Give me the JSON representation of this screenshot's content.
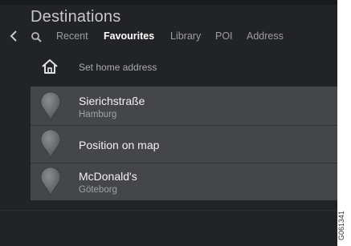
{
  "header": {
    "title": "Destinations"
  },
  "tabs": [
    {
      "label": "Recent",
      "active": false
    },
    {
      "label": "Favourites",
      "active": true
    },
    {
      "label": "Library",
      "active": false
    },
    {
      "label": "POI",
      "active": false
    },
    {
      "label": "Address",
      "active": false
    }
  ],
  "home": {
    "label": "Set home address",
    "icon": "home-icon"
  },
  "favourites": [
    {
      "name": "Sierichstraße",
      "city": "Hamburg",
      "icon": "location-pin-icon"
    },
    {
      "name": "Position on map",
      "city": "",
      "icon": "location-pin-icon"
    },
    {
      "name": "McDonald's",
      "city": "Göteborg",
      "icon": "location-pin-icon"
    }
  ],
  "figure_code": "G061341",
  "colors": {
    "background": "#222326",
    "list_background": "#444649",
    "active_tab": "#ffffff",
    "inactive_tab": "#9c9ea1"
  }
}
